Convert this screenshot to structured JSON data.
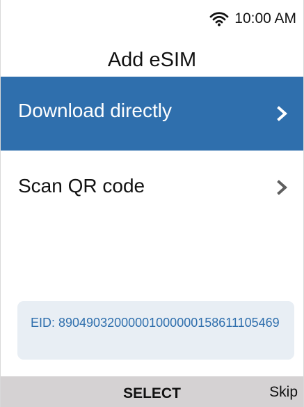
{
  "status_bar": {
    "time": "10:00 AM",
    "icons": [
      "wifi-icon"
    ]
  },
  "screen": {
    "title": "Add eSIM"
  },
  "menu": {
    "items": [
      {
        "label": "Download directly",
        "selected": true,
        "icon": "chevron-right-icon"
      },
      {
        "label": "Scan QR code",
        "selected": false,
        "icon": "chevron-right-icon"
      }
    ]
  },
  "eid": {
    "text": "EID: 89049032000001000000158611105469"
  },
  "soft_keys": {
    "center": "SELECT",
    "right": "Skip"
  },
  "colors": {
    "accent": "#2f6fad",
    "selected_text": "#ffffff",
    "eid_background": "#e8eef4",
    "softkey_background": "#d5d2d3"
  }
}
